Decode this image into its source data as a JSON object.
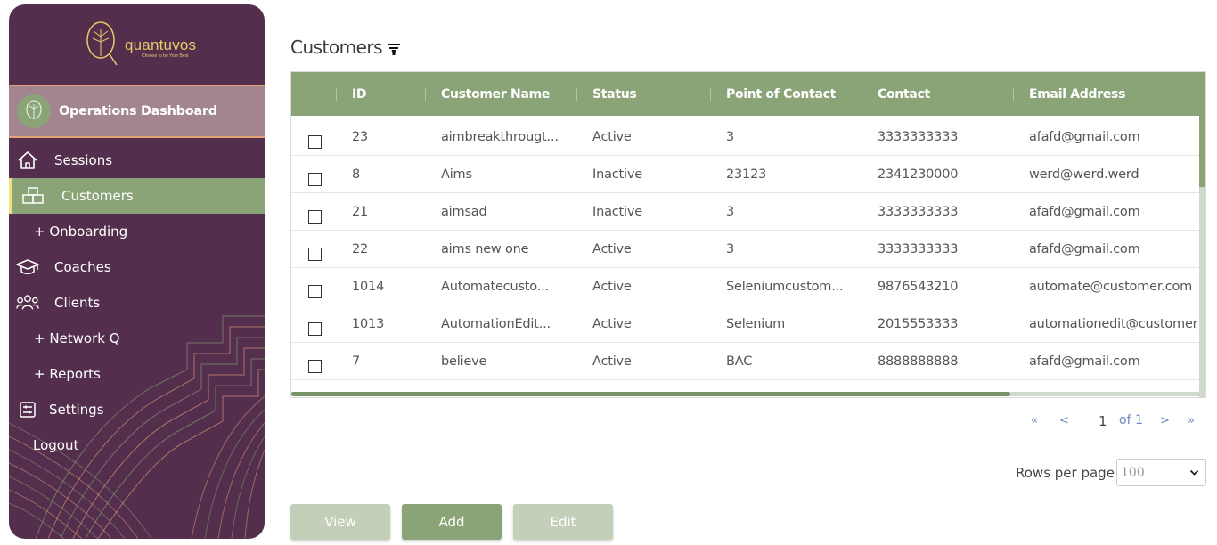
{
  "sidebar": {
    "logo_text": "quantuvos",
    "logo_tagline": "Choose to be Your Best",
    "dashboard_title": "Operations Dashboard",
    "items": [
      {
        "label": "Sessions",
        "icon": "home-icon"
      },
      {
        "label": "Customers",
        "icon": "boxes-icon"
      },
      {
        "label": "+ Onboarding"
      },
      {
        "label": "Coaches",
        "icon": "graduation-cap-icon"
      },
      {
        "label": "Clients",
        "icon": "users-icon"
      },
      {
        "label": "+ Network Q"
      },
      {
        "label": "+ Reports"
      },
      {
        "label": "Settings",
        "icon": "settings-sliders-icon"
      },
      {
        "label": "Logout"
      }
    ]
  },
  "page": {
    "title": "Customers"
  },
  "table": {
    "columns": [
      "ID",
      "Customer Name",
      "Status",
      "Point of Contact",
      "Contact",
      "Email Address"
    ],
    "rows": [
      {
        "id": "23",
        "name": "aimbreakthrougt...",
        "status": "Active",
        "poc": "3",
        "contact": "3333333333",
        "email": "afafd@gmail.com"
      },
      {
        "id": "8",
        "name": "Aims",
        "status": "Inactive",
        "poc": "23123",
        "contact": "2341230000",
        "email": "werd@werd.werd"
      },
      {
        "id": "21",
        "name": "aimsad",
        "status": "Inactive",
        "poc": "3",
        "contact": "3333333333",
        "email": "afafd@gmail.com"
      },
      {
        "id": "22",
        "name": "aims new one",
        "status": "Active",
        "poc": "3",
        "contact": "3333333333",
        "email": "afafd@gmail.com"
      },
      {
        "id": "1014",
        "name": "Automatecusto...",
        "status": "Active",
        "poc": "Seleniumcustom...",
        "contact": "9876543210",
        "email": "automate@customer.com"
      },
      {
        "id": "1013",
        "name": "AutomationEdit...",
        "status": "Active",
        "poc": "Selenium",
        "contact": "2015553333",
        "email": "automationedit@customer"
      },
      {
        "id": "7",
        "name": "believe",
        "status": "Active",
        "poc": "BAC",
        "contact": "8888888888",
        "email": "afafd@gmail.com"
      }
    ]
  },
  "pagination": {
    "first": "«",
    "prev": "<",
    "current": "1",
    "of_total": "of 1",
    "next": ">",
    "last": "»"
  },
  "rows_per_page": {
    "label": "Rows per page",
    "value": "100"
  },
  "buttons": {
    "view": "View",
    "add": "Add",
    "edit": "Edit"
  },
  "colors": {
    "sidebar_bg": "#542e4d",
    "accent_green": "#8aa377",
    "logo_gold": "#e8c96a"
  }
}
